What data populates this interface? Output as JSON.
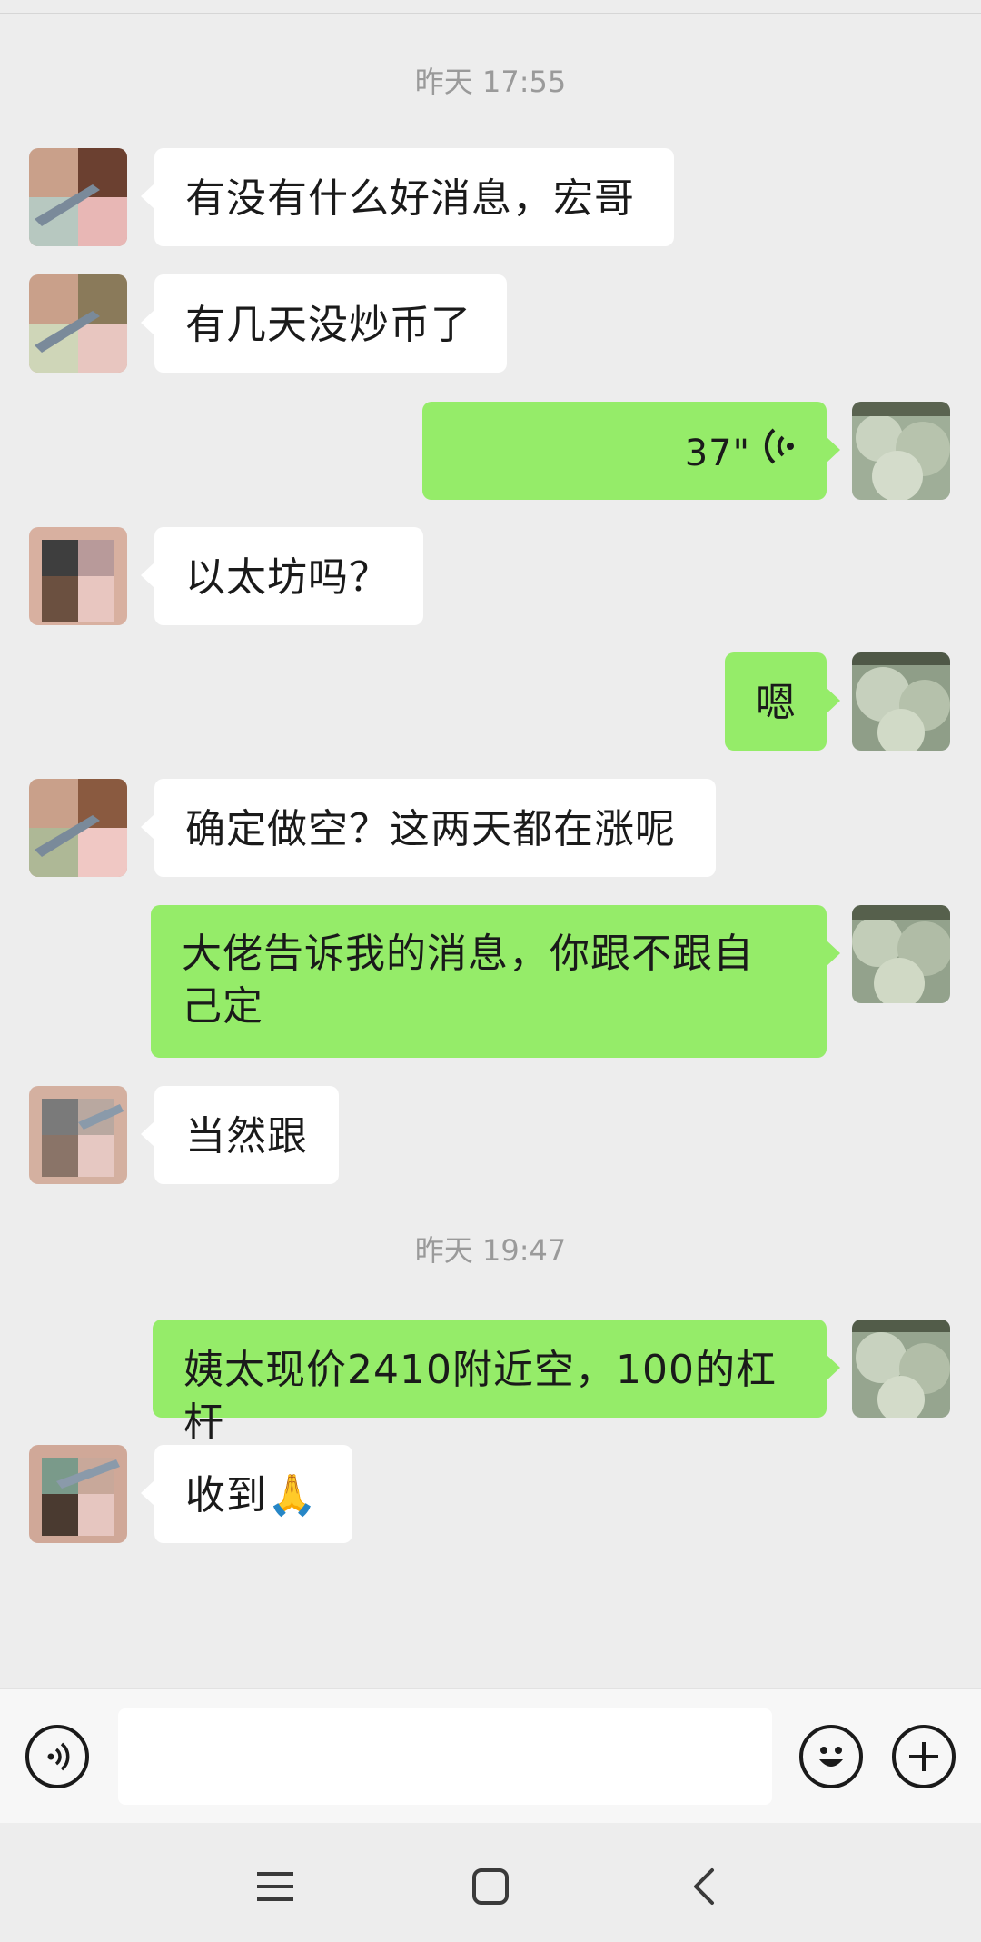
{
  "timestamps": [
    "昨天 17:55",
    "昨天 19:47"
  ],
  "messages": [
    {
      "side": "in",
      "text": "有没有什么好消息，宏哥"
    },
    {
      "side": "in",
      "text": "有几天没炒币了"
    },
    {
      "side": "out",
      "type": "voice",
      "duration": "37\""
    },
    {
      "side": "in",
      "text": "以太坊吗？"
    },
    {
      "side": "out",
      "text": "嗯"
    },
    {
      "side": "in",
      "text": "确定做空？这两天都在涨呢"
    },
    {
      "side": "out",
      "text_line1": "大佬告诉我的消息，你跟不跟自",
      "text_line2": "己定"
    },
    {
      "side": "in",
      "text": "当然跟"
    },
    {
      "side": "out",
      "text": "姨太现价2410附近空，100的杠杆"
    },
    {
      "side": "in",
      "text": "收到",
      "emoji": "🙏"
    }
  ],
  "input_bar": {
    "voice_icon": "voice-input-icon",
    "emoji_icon": "emoji-smile-icon",
    "plus_icon": "plus-icon"
  },
  "nav_bar": {
    "menu_icon": "menu-icon",
    "home_icon": "home-square-icon",
    "back_icon": "back-chevron-icon"
  },
  "colors": {
    "background": "#ededed",
    "outgoing_bubble": "#95ec69",
    "incoming_bubble": "#ffffff"
  }
}
